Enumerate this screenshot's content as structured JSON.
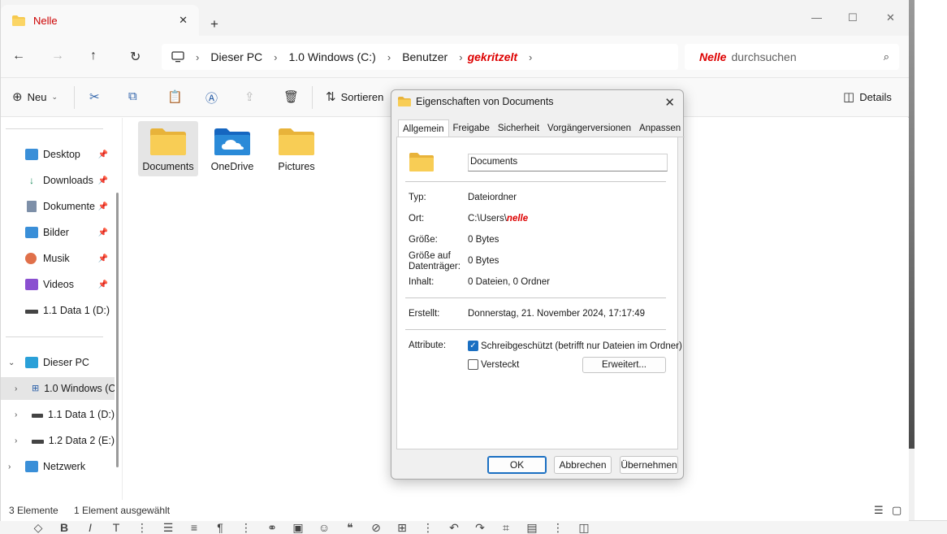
{
  "tab": {
    "title": "Nelle",
    "close": "✕",
    "new": "+"
  },
  "window_controls": {
    "minimize": "—",
    "maximize": "☐",
    "close": "✕"
  },
  "address": {
    "crumbs": [
      "Dieser PC",
      "1.0 Windows (C:)",
      "Benutzer"
    ],
    "redacted": "gekritzelt",
    "search_redacted": "Nelle",
    "search_suffix": "durchsuchen"
  },
  "commands": {
    "new": "Neu",
    "sort": "Sortieren",
    "details": "Details"
  },
  "sidebar": {
    "quick": [
      {
        "label": "Desktop",
        "icon": "desktop-icon",
        "pinned": true
      },
      {
        "label": "Downloads",
        "icon": "download-icon",
        "pinned": true
      },
      {
        "label": "Dokumente",
        "icon": "documents-icon",
        "pinned": true
      },
      {
        "label": "Bilder",
        "icon": "pictures-icon",
        "pinned": true
      },
      {
        "label": "Musik",
        "icon": "music-icon",
        "pinned": true
      },
      {
        "label": "Videos",
        "icon": "videos-icon",
        "pinned": true
      },
      {
        "label": "1.1 Data 1 (D:)",
        "icon": "drive-icon",
        "pinned": false
      }
    ],
    "this_pc": "Dieser PC",
    "drives": [
      "1.0 Windows (C:)",
      "1.1 Data 1 (D:)",
      "1.2 Data 2 (E:)"
    ],
    "network": "Netzwerk"
  },
  "files": [
    {
      "label": "Documents",
      "icon": "folder-icon",
      "selected": true
    },
    {
      "label": "OneDrive",
      "icon": "onedrive-folder-icon",
      "selected": false
    },
    {
      "label": "Pictures",
      "icon": "folder-icon",
      "selected": false
    }
  ],
  "status": {
    "count": "3 Elemente",
    "selection": "1 Element ausgewählt"
  },
  "dialog": {
    "title": "Eigenschaften von Documents",
    "tabs": [
      "Allgemein",
      "Freigabe",
      "Sicherheit",
      "Vorgängerversionen",
      "Anpassen"
    ],
    "active_tab": "Allgemein",
    "name": "Documents",
    "labels": {
      "type": "Typ:",
      "location": "Ort:",
      "size": "Größe:",
      "size_on_disk": "Größe auf Datenträger:",
      "contents": "Inhalt:",
      "created": "Erstellt:",
      "attributes": "Attribute:"
    },
    "values": {
      "type": "Dateiordner",
      "location": "C:\\Users\\",
      "location_redacted": "nelle",
      "size": "0 Bytes",
      "size_on_disk": "0 Bytes",
      "contents": "0 Dateien, 0 Ordner",
      "created": "Donnerstag, 21. November 2024, 17:17:49"
    },
    "readonly": {
      "label": "Schreibgeschützt (betrifft nur Dateien im Ordner)",
      "checked": true
    },
    "hidden": {
      "label": "Versteckt",
      "checked": false
    },
    "advanced": "Erweitert...",
    "ok": "OK",
    "cancel": "Abbrechen",
    "apply": "Übernehmen"
  },
  "colors": {
    "accent": "#1a6fc2",
    "folder": "#f6c94e",
    "redaction": "#d00000"
  }
}
